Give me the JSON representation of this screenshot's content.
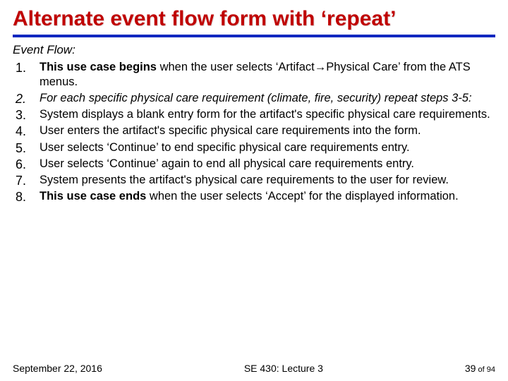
{
  "title": "Alternate event flow form with ‘repeat’",
  "section_label": "Event Flow:",
  "items": [
    {
      "lead": "This use case begins",
      "rest": " when the user selects ‘Artifact→Physical Care’ from the ATS menus.",
      "italic": false
    },
    {
      "lead": "",
      "rest": "For each specific physical care requirement (climate, fire, security) repeat steps 3‑5:",
      "italic": true
    },
    {
      "lead": "",
      "rest": "System displays a blank entry form for the artifact's specific physical care requirements.",
      "italic": false
    },
    {
      "lead": "",
      "rest": "User enters the artifact's specific physical care requirements into the form.",
      "italic": false
    },
    {
      "lead": "",
      "rest": "User selects ‘Continue’ to end specific physical care requirements entry.",
      "italic": false
    },
    {
      "lead": "",
      "rest": "User selects ‘Continue’ again to end all physical care requirements entry.",
      "italic": false
    },
    {
      "lead": "",
      "rest": "System presents the artifact's physical care requirements to the user for review.",
      "italic": false
    },
    {
      "lead": "This use case ends",
      "rest": " when the user selects ‘Accept’ for the displayed information.",
      "italic": false
    }
  ],
  "footer": {
    "left": "September 22, 2016",
    "center": "SE 430: Lecture 3",
    "right_page": "39",
    "right_of": " of ",
    "right_total": "94"
  }
}
